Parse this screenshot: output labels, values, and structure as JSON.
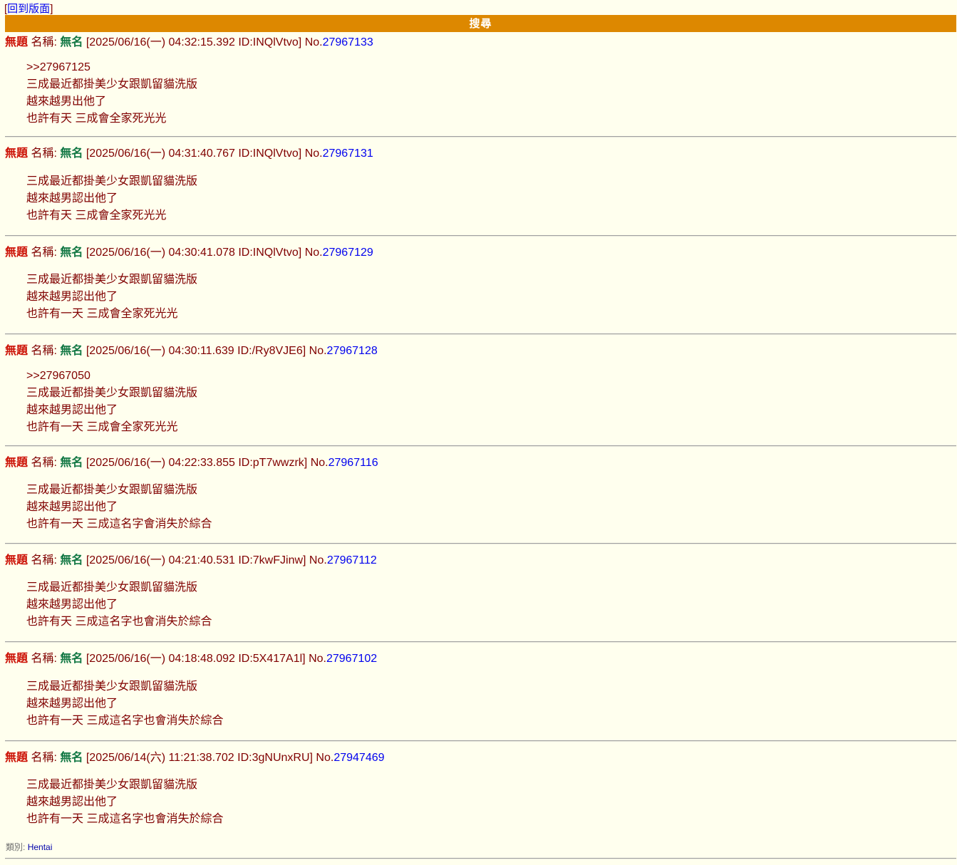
{
  "nav": {
    "bracket_open": "[",
    "back_label": "回到版面",
    "bracket_close": "]"
  },
  "title_bar": "搜尋",
  "labels": {
    "name_label": "名稱:",
    "no_prefix": "No."
  },
  "posts": [
    {
      "subject": "無題",
      "name": "無名",
      "meta": "[2025/06/16(一) 04:32:15.392 ID:INQlVtvo]",
      "number": "27967133",
      "lines": [
        "&gt;&gt;27967125",
        "三成最近都掛美少女跟凱留貓洗版",
        "越來越男出他了",
        "也許有天 三成會全家死光光"
      ]
    },
    {
      "subject": "無題",
      "name": "無名",
      "meta": "[2025/06/16(一) 04:31:40.767 ID:INQlVtvo]",
      "number": "27967131",
      "lines": [
        "三成最近都掛美少女跟凱留貓洗版",
        "越來越男認出他了",
        "也許有天 三成會全家死光光"
      ]
    },
    {
      "subject": "無題",
      "name": "無名",
      "meta": "[2025/06/16(一) 04:30:41.078 ID:INQlVtvo]",
      "number": "27967129",
      "lines": [
        "三成最近都掛美少女跟凱留貓洗版",
        "越來越男認出他了",
        "也許有一天 三成會全家死光光"
      ]
    },
    {
      "subject": "無題",
      "name": "無名",
      "meta": "[2025/06/16(一) 04:30:11.639 ID:/Ry8VJE6]",
      "number": "27967128",
      "lines": [
        "&gt;&gt;27967050",
        "三成最近都掛美少女跟凱留貓洗版",
        "越來越男認出他了",
        "也許有一天 三成會全家死光光"
      ]
    },
    {
      "subject": "無題",
      "name": "無名",
      "meta": "[2025/06/16(一) 04:22:33.855 ID:pT7wwzrk]",
      "number": "27967116",
      "lines": [
        "三成最近都掛美少女跟凱留貓洗版",
        "越來越男認出他了",
        "也許有一天 三成這名字會消失於綜合"
      ]
    },
    {
      "subject": "無題",
      "name": "無名",
      "meta": "[2025/06/16(一) 04:21:40.531 ID:7kwFJinw]",
      "number": "27967112",
      "lines": [
        "三成最近都掛美少女跟凱留貓洗版",
        "越來越男認出他了",
        "也許有天 三成這名字也會消失於綜合"
      ]
    },
    {
      "subject": "無題",
      "name": "無名",
      "meta": "[2025/06/16(一) 04:18:48.092 ID:5X417A1l]",
      "number": "27967102",
      "lines": [
        "三成最近都掛美少女跟凱留貓洗版",
        "越來越男認出他了",
        "也許有一天 三成這名字也會消失於綜合"
      ]
    },
    {
      "subject": "無題",
      "name": "無名",
      "meta": "[2025/06/14(六) 11:21:38.702 ID:3gNUnxRU]",
      "number": "27947469",
      "lines": [
        "三成最近都掛美少女跟凱留貓洗版",
        "越來越男認出他了",
        "也許有一天 三成這名字也會消失於綜合"
      ]
    }
  ],
  "category": {
    "label": "類別:",
    "value": "Hentai"
  }
}
